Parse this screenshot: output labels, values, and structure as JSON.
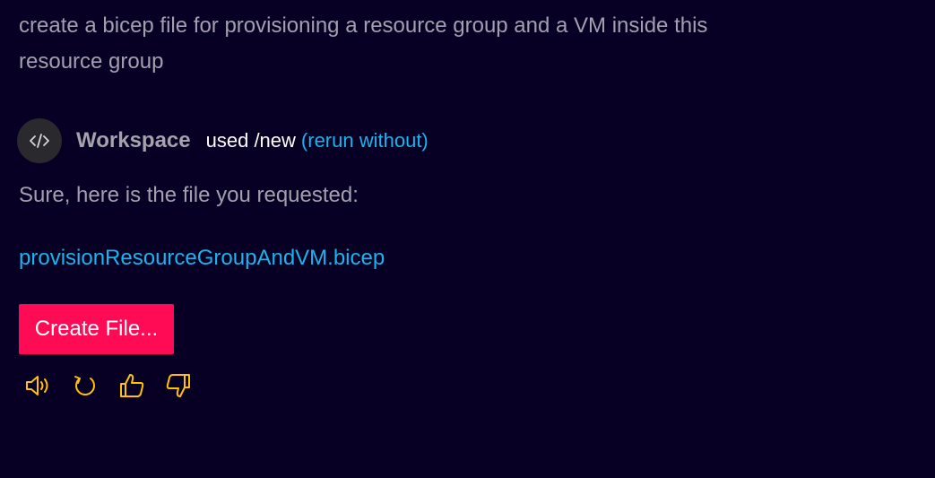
{
  "prompt": {
    "text": "create a bicep file for provisioning a resource group and a VM inside this resource group"
  },
  "response": {
    "avatar_icon": "code-icon",
    "agent_name": "Workspace",
    "used_command": "used /new",
    "rerun_label": "(rerun without)",
    "reply_text": "Sure, here is the file you requested:",
    "file_name": "provisionResourceGroupAndVM.bicep",
    "create_button_label": "Create File..."
  },
  "actions": [
    {
      "icon": "speaker-icon"
    },
    {
      "icon": "retry-icon"
    },
    {
      "icon": "thumbs-up-icon"
    },
    {
      "icon": "thumbs-down-icon"
    }
  ],
  "colors": {
    "background": "#080024",
    "accent_button": "#ff0a55",
    "link": "#1ab4ec",
    "icon": "#ffc300"
  }
}
